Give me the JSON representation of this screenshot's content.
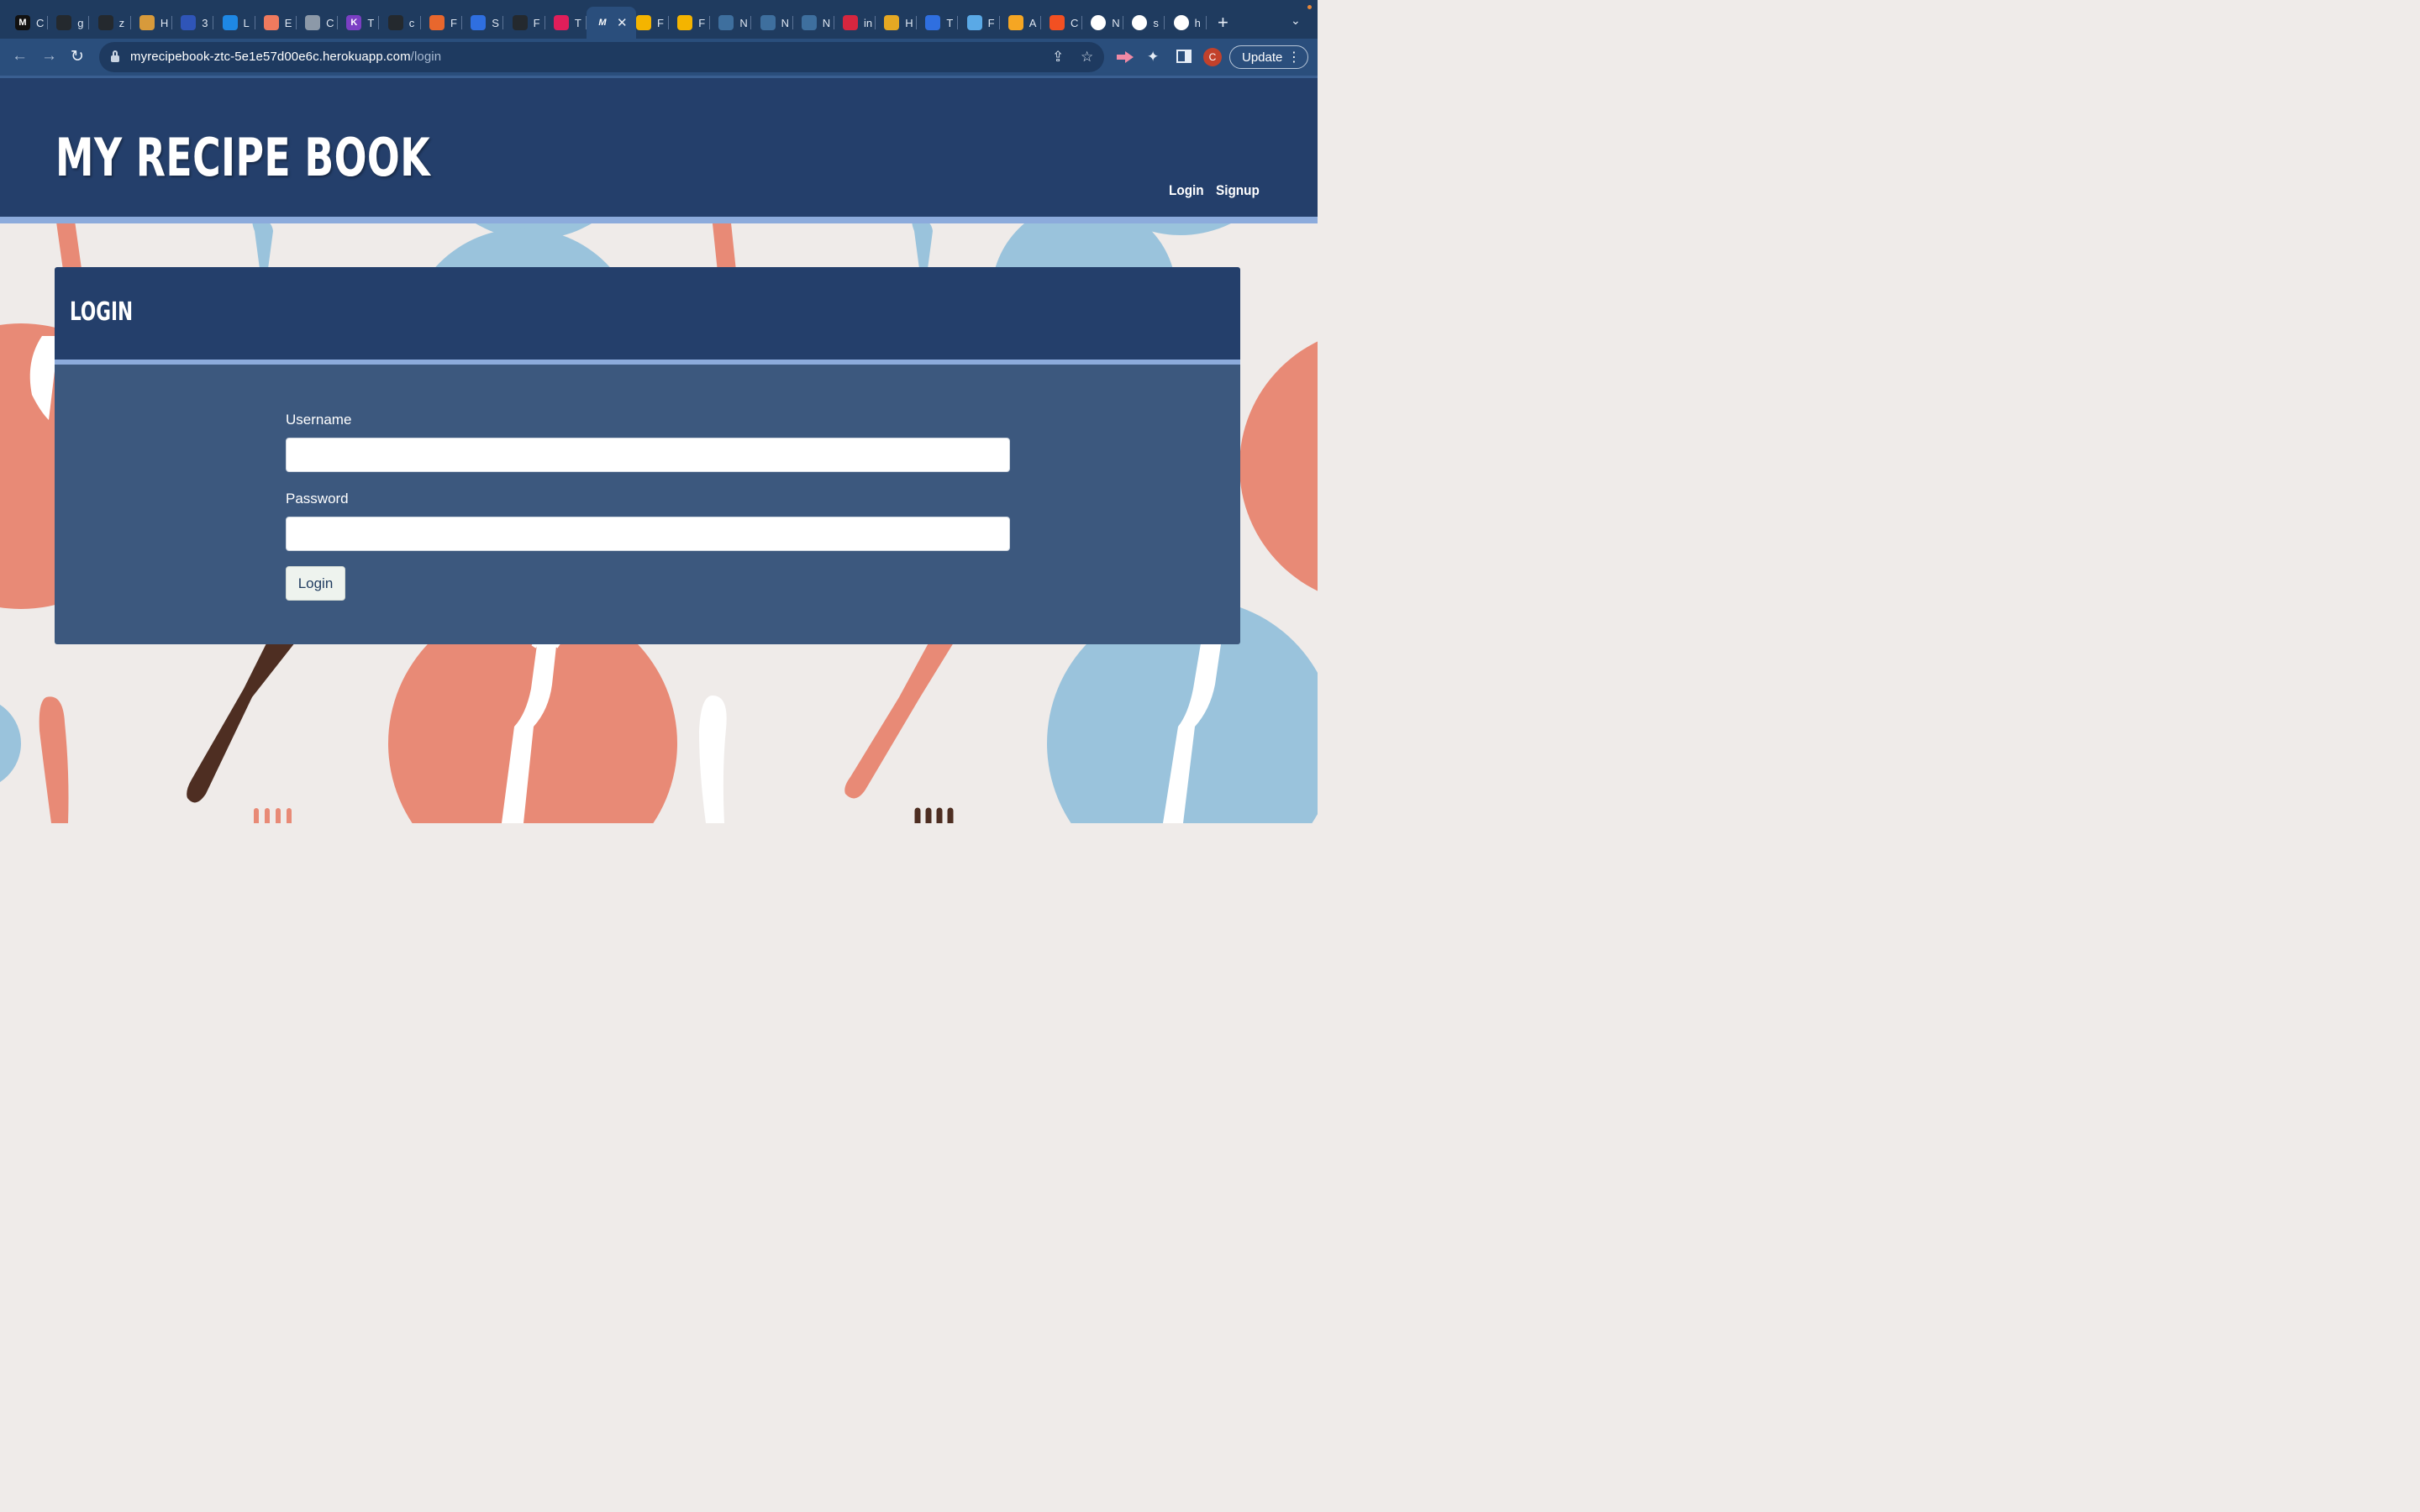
{
  "browser": {
    "tabs": [
      {
        "letter": "M",
        "title": "C",
        "color": "#111111",
        "fg": "#ffffff"
      },
      {
        "letter": "",
        "title": "g",
        "color": "#24292e",
        "icon": "github-icon"
      },
      {
        "letter": "",
        "title": "z",
        "color": "#24292e",
        "icon": "github-icon"
      },
      {
        "letter": "",
        "title": "H",
        "color": "#d79a3b",
        "icon": "cup-icon"
      },
      {
        "letter": "",
        "title": "3",
        "color": "#2f55b8",
        "icon": "map-icon"
      },
      {
        "letter": "",
        "title": "L",
        "color": "#1e88e5",
        "icon": "line-icon"
      },
      {
        "letter": "",
        "title": "E",
        "color": "#ef7a5e",
        "icon": "gradient-icon"
      },
      {
        "letter": "",
        "title": "C",
        "color": "#8c99a8",
        "icon": "globe-icon"
      },
      {
        "letter": "K",
        "title": "T",
        "color": "#7b3fc4",
        "fg": "#ffffff"
      },
      {
        "letter": "",
        "title": "c",
        "color": "#24292e",
        "icon": "github-icon"
      },
      {
        "letter": "",
        "title": "F",
        "color": "#e8672d",
        "icon": "b3-icon"
      },
      {
        "letter": "",
        "title": "S",
        "color": "#2f6fe0",
        "icon": "q-icon"
      },
      {
        "letter": "",
        "title": "F",
        "color": "#24292e",
        "icon": "github-icon"
      },
      {
        "letter": "",
        "title": "T",
        "color": "#e01e5a",
        "icon": "slack-icon"
      }
    ],
    "active_tab": {
      "title": "M",
      "close": "✕"
    },
    "tabs_after": [
      {
        "title": "F",
        "color": "#f4b400",
        "icon": "slides-icon"
      },
      {
        "title": "F",
        "color": "#f4b400",
        "icon": "slides-icon"
      },
      {
        "title": "N",
        "color": "#3e6f9e",
        "icon": "leaf-icon"
      },
      {
        "title": "N",
        "color": "#3e6f9e",
        "icon": "leaf-icon"
      },
      {
        "title": "N",
        "color": "#3e6f9e",
        "icon": "leaf-icon"
      },
      {
        "title": "in",
        "color": "#d6263f",
        "icon": "n-icon"
      },
      {
        "title": "H",
        "color": "#e5a823",
        "icon": "fs-icon"
      },
      {
        "title": "T",
        "color": "#2f6fe0",
        "icon": "q-icon"
      },
      {
        "title": "F",
        "color": "#5aa9e6",
        "icon": "wave-icon"
      },
      {
        "title": "A",
        "color": "#f5a623",
        "icon": "u-icon"
      },
      {
        "title": "C",
        "color": "#f25022",
        "icon": "windows-icon"
      },
      {
        "title": "N",
        "color": "#ffffff",
        "icon": "chrome-icon"
      },
      {
        "title": "s",
        "color": "#ffffff",
        "icon": "google-icon"
      },
      {
        "title": "h",
        "color": "#ffffff",
        "icon": "google-icon"
      }
    ],
    "new_tab": "+",
    "tab_list": "⌄",
    "url_host": "myrecipebook-ztc-5e1e57d00e6c.herokuapp.com",
    "url_path": "/login",
    "profile_letter": "C",
    "update_label": "Update"
  },
  "site": {
    "title": "MY RECIPE BOOK",
    "nav": {
      "login": "Login",
      "signup": "Signup"
    }
  },
  "login_card": {
    "heading": "LOGIN",
    "username_label": "Username",
    "username_value": "",
    "password_label": "Password",
    "password_value": "",
    "submit_label": "Login"
  },
  "colors": {
    "header_navy": "#243f6b",
    "accent_stripe": "#8cabdc",
    "card_body": "#3c587e",
    "plate_coral": "#e88a76",
    "plate_blue": "#9ac3dc",
    "background": "#efebe9"
  }
}
